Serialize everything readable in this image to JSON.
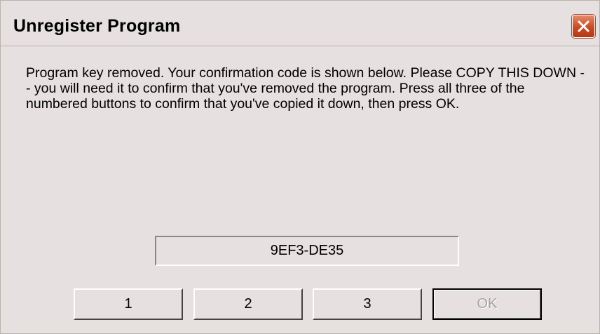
{
  "window": {
    "title": "Unregister Program",
    "close_icon": "close-icon"
  },
  "message": "Program key removed. Your confirmation code is shown below. Please COPY THIS DOWN -- you will need it to confirm that you've removed the program. Press all three of the numbered buttons to confirm that you've copied it down, then press OK.",
  "confirmation_code": "9EF3-DE35",
  "buttons": {
    "one": "1",
    "two": "2",
    "three": "3",
    "ok": "OK",
    "ok_enabled": false
  },
  "colors": {
    "dialog_background": "#e6e0e0",
    "close_button": "#cc4a22",
    "disabled_text": "#a6a3a3"
  }
}
